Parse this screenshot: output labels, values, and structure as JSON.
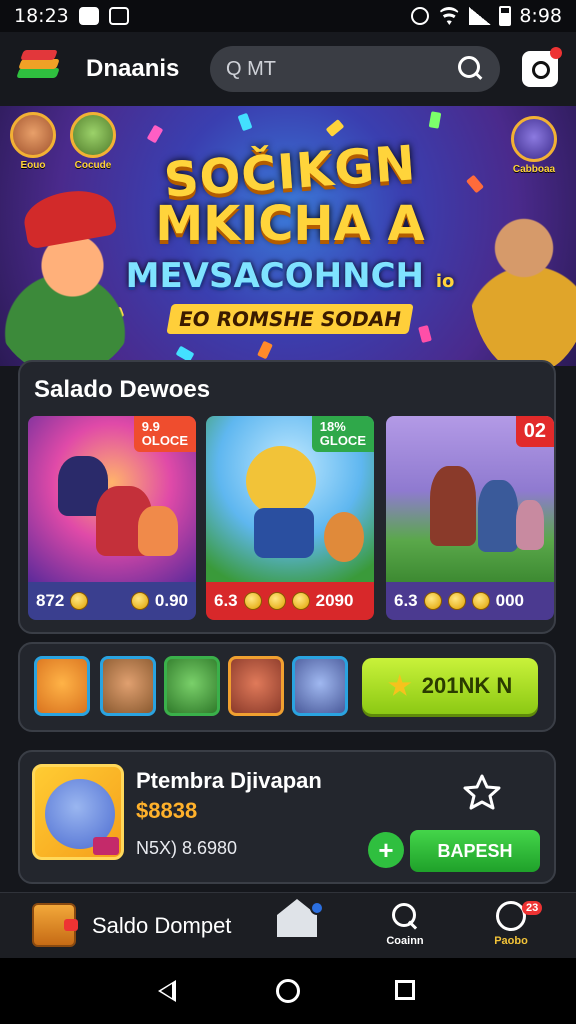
{
  "status_bar": {
    "time": "18:23",
    "right_time": "8:98"
  },
  "app_bar": {
    "title": "Dnaanis",
    "search_placeholder": "Q MT"
  },
  "banner": {
    "line1": "SOČIKGN",
    "line2": "MKICHA",
    "line3": "MEVSACOHNCH",
    "line4": "EO ROMSHE SODAH",
    "suffix": "A",
    "suffix_small": "io",
    "left_badges": [
      "Eouo",
      "Cocude"
    ],
    "right_badge": "Cabboaa"
  },
  "selected": {
    "title": "Salado Dewoes",
    "games": [
      {
        "tag": "9.9\nOLOCE",
        "tag_color": "#ef4d2e",
        "price": "872",
        "coins": "0.90",
        "foot_color": "#3a3f8f"
      },
      {
        "tag": "18%\nGLOCE",
        "tag_color": "#2fa84a",
        "price": "6.3",
        "coins": "2090",
        "foot_color": "#d8282a"
      },
      {
        "tag": "02",
        "tag_color": "#e22a2a",
        "price": "6.3",
        "coins": "000",
        "foot_color": "#4b3a90"
      }
    ]
  },
  "avatars_row": {
    "claim_label": "201NK N"
  },
  "featured": {
    "name": "Ptembra Djivapan",
    "price": "$8838",
    "meta": "N5X) 8.6980",
    "buy_label": "BAPESH",
    "plus_label": "+"
  },
  "bottom_nav": {
    "wallet_label": "Saldo Dompet",
    "search_label": "Coainn",
    "profile_label": "Paobo",
    "profile_badge": "23"
  }
}
